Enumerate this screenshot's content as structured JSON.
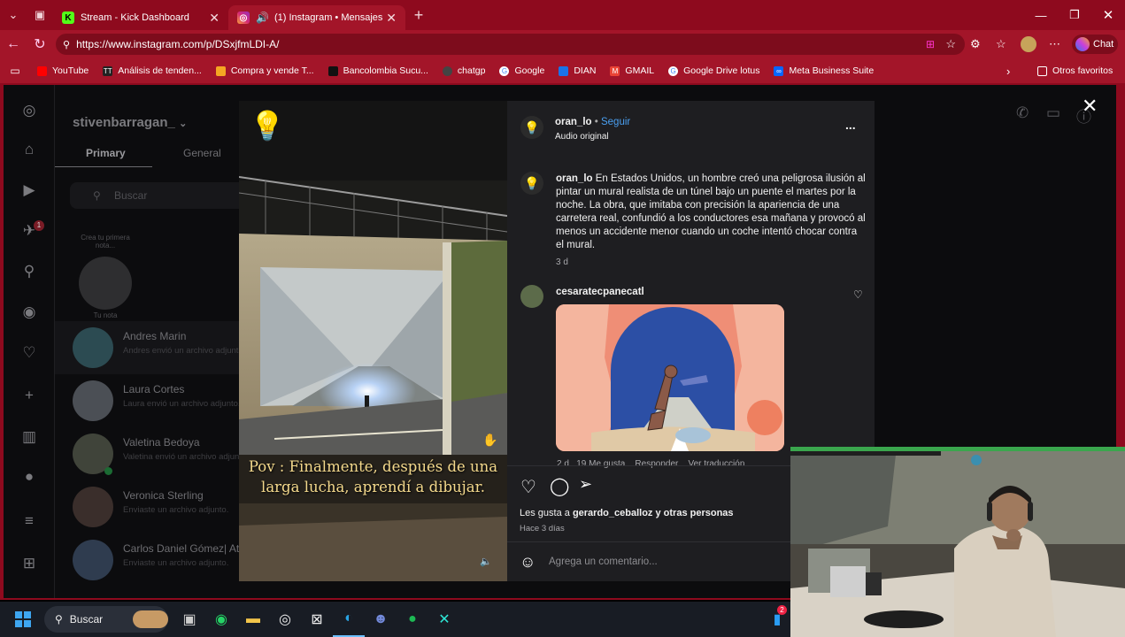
{
  "tabs": [
    {
      "title": "Stream - Kick Dashboard",
      "icon": "kick-icon"
    },
    {
      "title": "(1) Instagram • Mensajes",
      "icon": "instagram-icon"
    }
  ],
  "url": "https://www.instagram.com/p/DSxjfmLDI-A/",
  "chat_button": "Chat",
  "bookmarks": [
    "YouTube",
    "Análisis de tenden...",
    "Compra y vende T...",
    "Bancolombia Sucu...",
    "chatgp",
    "Google",
    "DIAN",
    "GMAIL",
    "Google Drive lotus",
    "Meta Business Suite"
  ],
  "other_bookmarks": "Otros favoritos",
  "inbox": {
    "username": "stivenbarragan_",
    "tab_primary": "Primary",
    "tab_general": "General",
    "search_placeholder": "Buscar",
    "note_prompt": "Crea tu primera nota...",
    "note_label": "Tu nota",
    "notification_count": "1",
    "chats": [
      {
        "name": "Andres Marin",
        "snippet": "Andres envió un archivo adjunto."
      },
      {
        "name": "Laura Cortes",
        "snippet": "Laura envió un archivo adjunto."
      },
      {
        "name": "Valetina Bedoya",
        "snippet": "Valetina envió un archivo adjunto."
      },
      {
        "name": "Veronica Sterling",
        "snippet": "Enviaste un archivo adjunto."
      },
      {
        "name": "Carlos Daniel Gómez| Atle",
        "snippet": "Enviaste un archivo adjunto."
      }
    ]
  },
  "video": {
    "subtitle": "Pov : Finalmente, después de una larga lucha, aprendí a dibujar."
  },
  "post": {
    "author": "oran_lo",
    "follow": "Seguir",
    "dot": "•",
    "audio": "Audio original",
    "more": "...",
    "caption_author": "oran_lo",
    "caption": "En Estados Unidos, un hombre creó una peligrosa ilusión al pintar un mural realista de un túnel bajo un puente el martes por la noche. La obra, que imitaba con precisión la apariencia de una carretera real, confundió a los conductores esa mañana y provocó al menos un accidente menor cuando un coche intentó chocar contra el mural.",
    "caption_age": "3 d",
    "comment_author": "cesaratecpanecatl",
    "comment_age": "2 d",
    "comment_likes": "19 Me gusta",
    "comment_reply": "Responder",
    "comment_translate": "Ver traducción",
    "likes_prefix": "Les gusta a",
    "likes_user": "gerardo_ceballoz",
    "likes_suffix": "y otras personas",
    "posted": "Hace 3 días",
    "comment_placeholder": "Agrega un comentario..."
  },
  "taskbar": {
    "search": "Buscar",
    "badge": "2"
  }
}
